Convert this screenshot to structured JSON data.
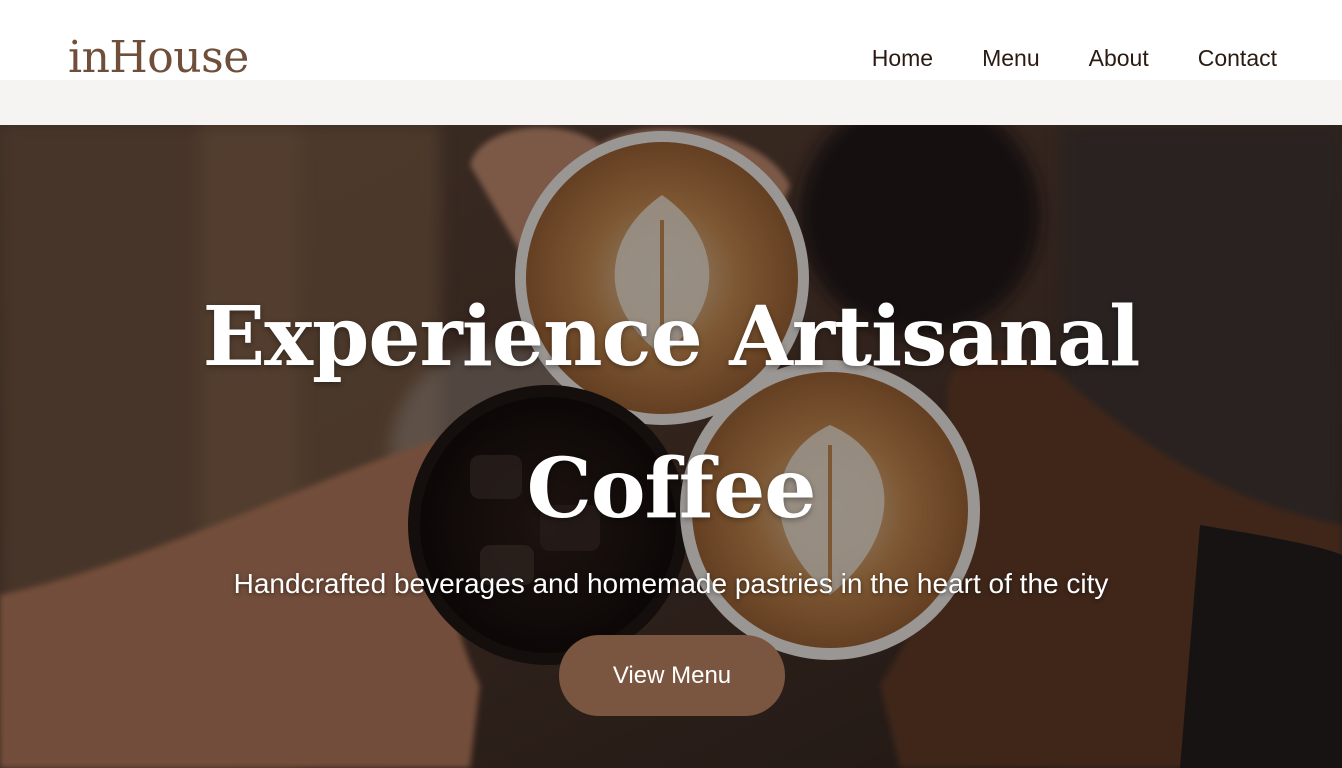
{
  "brand": {
    "logo_text": "inHouse"
  },
  "nav": {
    "items": [
      {
        "label": "Home"
      },
      {
        "label": "Menu"
      },
      {
        "label": "About"
      },
      {
        "label": "Contact"
      }
    ]
  },
  "hero": {
    "title_line1": "Experience Artisanal",
    "title_line2": "Coffee",
    "subtitle": "Handcrafted beverages and homemade pastries in the heart of the city",
    "cta_label": "View Menu",
    "image_icon": "coffee-cups-cheers-photo"
  },
  "colors": {
    "brand_brown": "#6f4f3a",
    "button_brown": "#7a5640",
    "nav_text": "#2a1a12"
  }
}
